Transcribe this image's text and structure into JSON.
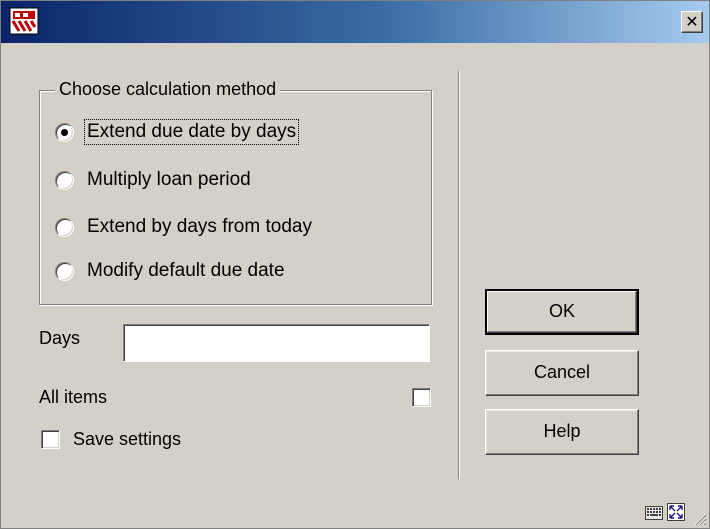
{
  "window": {
    "app_icon": "library-app-icon",
    "close_glyph": "✕"
  },
  "calculation": {
    "legend": "Choose calculation method",
    "options": [
      {
        "label": "Extend due date by days",
        "checked": true
      },
      {
        "label": "Multiply loan period",
        "checked": false
      },
      {
        "label": "Extend by days from today",
        "checked": false
      },
      {
        "label": "Modify default due date",
        "checked": false
      }
    ]
  },
  "days": {
    "label": "Days",
    "value": ""
  },
  "all_items": {
    "label": "All items",
    "checked": false
  },
  "save_settings": {
    "label": "Save settings",
    "checked": false
  },
  "buttons": {
    "ok": "OK",
    "cancel": "Cancel",
    "help": "Help"
  },
  "status_icons": [
    "keyboard-icon",
    "resize-window-icon",
    "size-grip-icon"
  ],
  "colors": {
    "face": "#d4d0c8",
    "titlebar_start": "#0a246a",
    "titlebar_end": "#a6caf0"
  }
}
